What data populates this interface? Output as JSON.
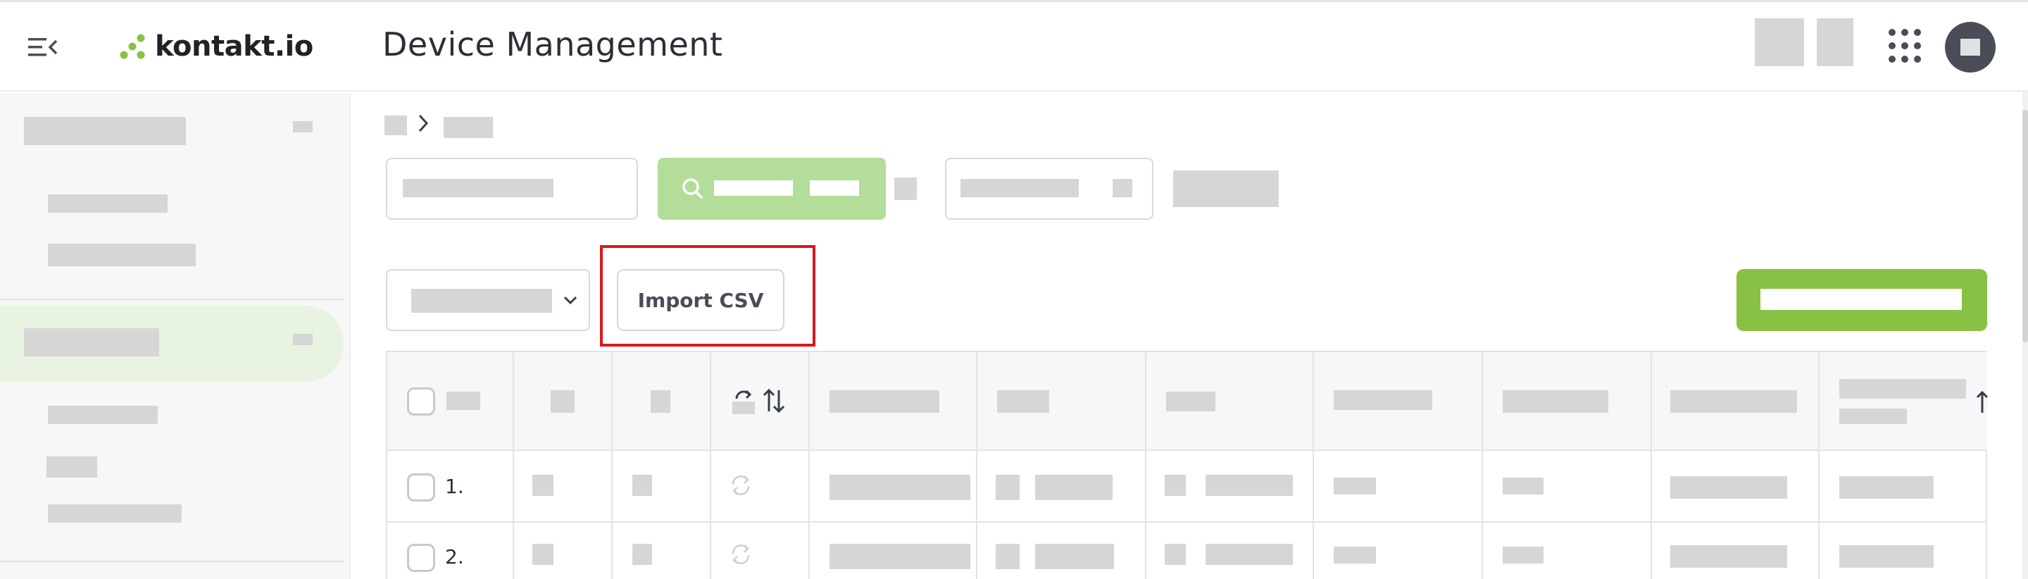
{
  "header": {
    "logo_text": "kontakt.io",
    "title": "Device Management"
  },
  "toolbar": {
    "import_csv_label": "Import CSV"
  },
  "table": {
    "rows": [
      {
        "index": "1."
      },
      {
        "index": "2."
      }
    ]
  },
  "colors": {
    "brand_green": "#88c144",
    "search_green": "#b3dd99",
    "highlight_red": "#d5191c",
    "avatar": "#4a4d57"
  },
  "icons": {
    "menu": "menu-collapse-icon",
    "logo": "kontakt-logo-icon",
    "apps": "apps-grid-icon",
    "search": "search-icon",
    "dropdown": "chevron-down-icon",
    "sync": "sync-icon",
    "sort": "sort-icon",
    "breadcrumb": "chevron-right-icon"
  }
}
